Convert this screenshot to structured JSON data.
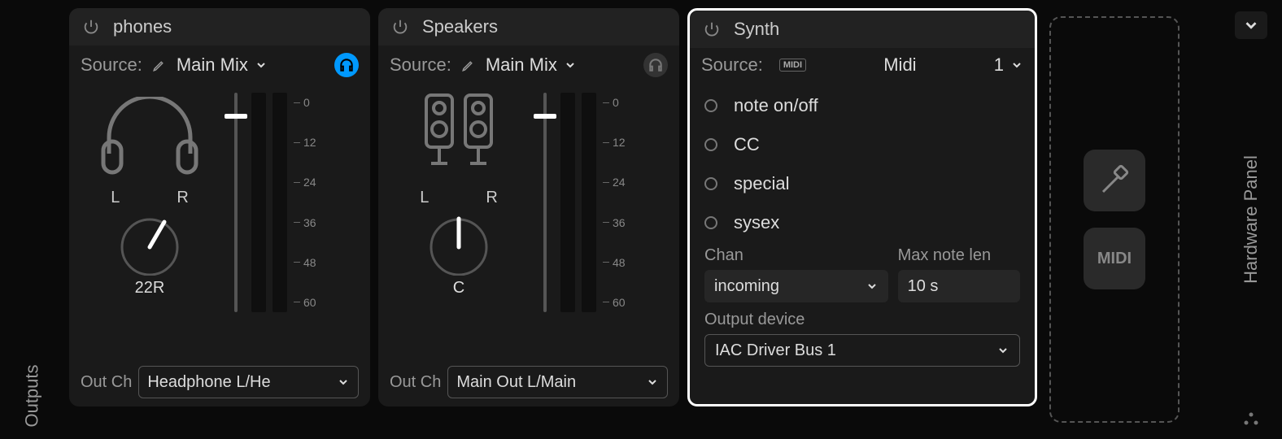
{
  "columns": {
    "outputs": "Outputs",
    "hardware": "Hardware Panel"
  },
  "panels": {
    "phones": {
      "title": "phones",
      "source_label": "Source:",
      "source_value": "Main Mix",
      "pan": {
        "left": "L",
        "right": "R",
        "value": "22R"
      },
      "scale": [
        "0",
        "12",
        "24",
        "36",
        "48",
        "60"
      ],
      "out_label": "Out Ch",
      "out_value": "Headphone L/He"
    },
    "speakers": {
      "title": "Speakers",
      "source_label": "Source:",
      "source_value": "Main Mix",
      "pan": {
        "left": "L",
        "right": "R",
        "value": "C"
      },
      "scale": [
        "0",
        "12",
        "24",
        "36",
        "48",
        "60"
      ],
      "out_label": "Out Ch",
      "out_value": "Main Out L/Main"
    },
    "synth": {
      "title": "Synth",
      "source_label": "Source:",
      "midi_badge": "MIDI",
      "source_value": "Midi",
      "channel_num": "1",
      "filters": [
        "note on/off",
        "CC",
        "special",
        "sysex"
      ],
      "chan_label": "Chan",
      "chan_value": "incoming",
      "maxlen_label": "Max note len",
      "maxlen_value": "10 s",
      "outdev_label": "Output device",
      "outdev_value": "IAC Driver Bus 1"
    }
  },
  "dropzone": {
    "midi_label": "MIDI"
  }
}
